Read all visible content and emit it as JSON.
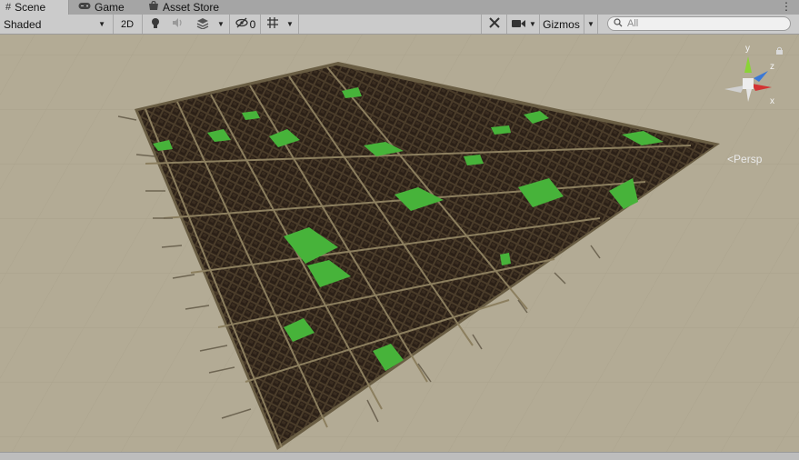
{
  "tabs": [
    {
      "label": "Scene",
      "icon": "grid-icon"
    },
    {
      "label": "Game",
      "icon": "gamepad-icon"
    },
    {
      "label": "Asset Store",
      "icon": "store-icon"
    }
  ],
  "tab_menu_icon": "⋮",
  "toolbar": {
    "shading_mode": "Shaded",
    "mode_2d": "2D",
    "hidden_count": "0",
    "gizmos_label": "Gizmos",
    "search_placeholder": "All"
  },
  "gizmo": {
    "axis_y": "y",
    "axis_z": "z",
    "axis_x": "x",
    "projection_label": "Persp"
  },
  "colors": {
    "ground": "#b3ab95",
    "grid_line": "#a9a18b",
    "road": "#7d7153",
    "building": "#2e2219",
    "park": "#47b33a",
    "gizmo_y": "#8ad336",
    "gizmo_x": "#d33333",
    "gizmo_z": "#3a78d6"
  }
}
